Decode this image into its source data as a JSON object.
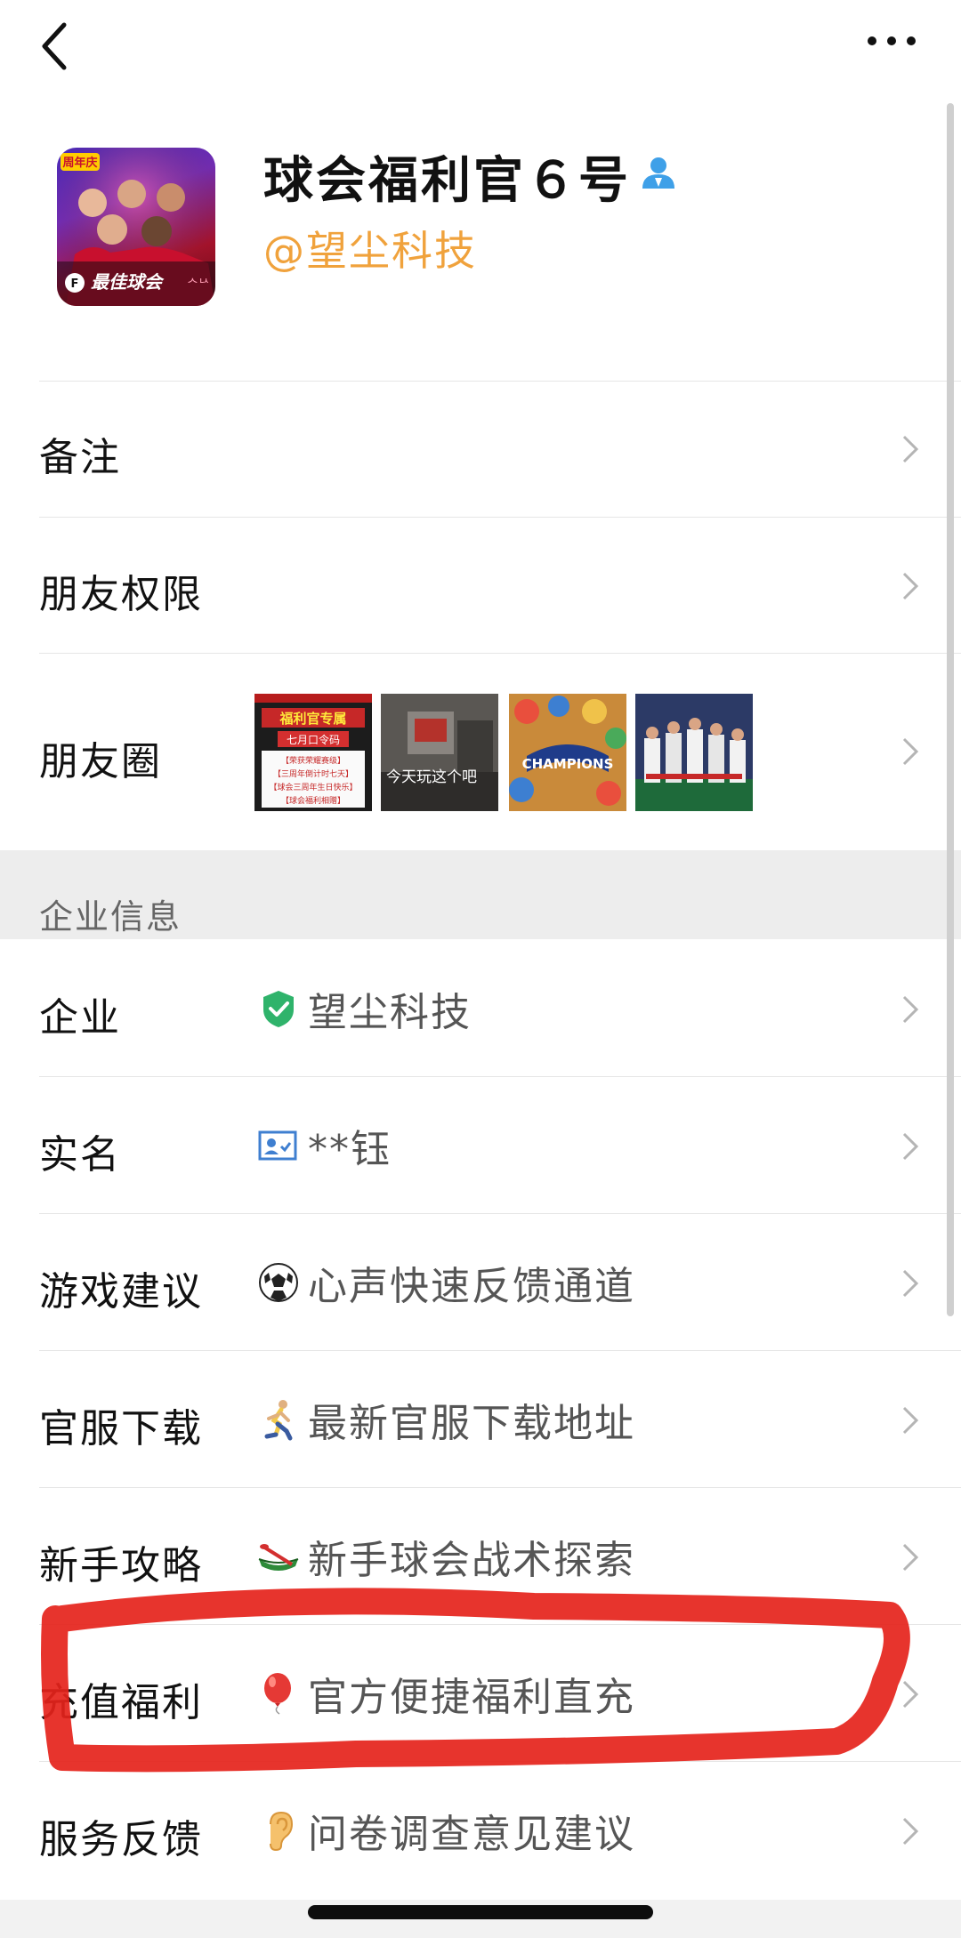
{
  "header": {
    "back_icon": "chevron-left-icon",
    "more_icon": "more-horizontal-icon"
  },
  "profile": {
    "name": "球会福利官６号",
    "handle": "@望尘科技",
    "badge_icon": "enterprise-contact-icon",
    "avatar_text": "最佳球会",
    "avatar_tag": "周年庆"
  },
  "rows": {
    "note": {
      "label": "备注"
    },
    "permission": {
      "label": "朋友权限"
    },
    "moments": {
      "label": "朋友圈",
      "thumbs": [
        {
          "title": "福利官专属",
          "sub": "七月口令码",
          "lines": [
            "【荣获荣耀赛级】",
            "【三周年倒计时七天】",
            "【球会三周年生日快乐】",
            "【球会福利相赠】"
          ]
        },
        {
          "caption": "今天玩这个吧"
        },
        {
          "caption": "CHAMPIONS"
        },
        {
          "caption": ""
        }
      ]
    }
  },
  "enterprise": {
    "section_title": "企业信息",
    "items": [
      {
        "label": "企业",
        "icon": "verified-shield-icon",
        "value": "望尘科技"
      },
      {
        "label": "实名",
        "icon": "id-card-icon",
        "value": "**钰"
      },
      {
        "label": "游戏建议",
        "icon": "soccer-ball-icon",
        "value": "心声快速反馈通道"
      },
      {
        "label": "官服下载",
        "icon": "running-person-icon",
        "value": "最新官服下载地址"
      },
      {
        "label": "新手攻略",
        "icon": "canoe-icon",
        "value": "新手球会战术探索"
      },
      {
        "label": "充值福利",
        "icon": "balloon-icon",
        "value": "官方便捷福利直充"
      },
      {
        "label": "服务反馈",
        "icon": "ear-icon",
        "value": "问卷调查意见建议"
      }
    ]
  },
  "colors": {
    "handle": "#f0a23c",
    "badge": "#3fa0e8",
    "verified": "#2fb36b",
    "annotation": "#e5231b",
    "section_bg": "#ededed"
  }
}
